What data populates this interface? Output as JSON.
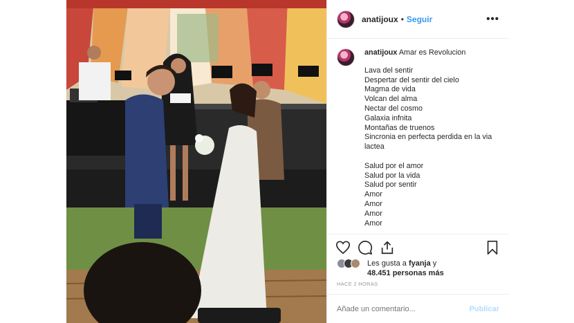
{
  "header": {
    "username": "anatijoux",
    "separator": "•",
    "follow_label": "Seguir",
    "more_glyph": "•••"
  },
  "caption": {
    "username": "anatijoux",
    "first_line": "Amar es Revolucion",
    "lines": [
      "Lava del sentir",
      "Despertar del sentir del cielo",
      "Magma de vida",
      "Volcan del alma",
      "Nectar del cosmo",
      "Galaxia infnita",
      "Montañas de truenos",
      "Sincronia en perfecta perdida en la via lactea",
      "",
      "Salud por el amor",
      "Salud por la vida",
      "Salud por sentir",
      "Amor",
      "Amor",
      "Amor",
      "Amor"
    ]
  },
  "likes": {
    "prefix": "Les gusta a",
    "user": "fyanja",
    "joiner": "y",
    "count": "48.451 personas más"
  },
  "timestamp": "HACE 2 HORAS",
  "comment_box": {
    "placeholder": "Añade un comentario...",
    "publish_label": "Publicar"
  },
  "icons": [
    "heart-icon",
    "comment-icon",
    "share-icon",
    "bookmark-icon"
  ],
  "colors": {
    "accent": "#3897f0",
    "publish_disabled": "#b3dbff",
    "text": "#262626",
    "muted": "#999999"
  }
}
